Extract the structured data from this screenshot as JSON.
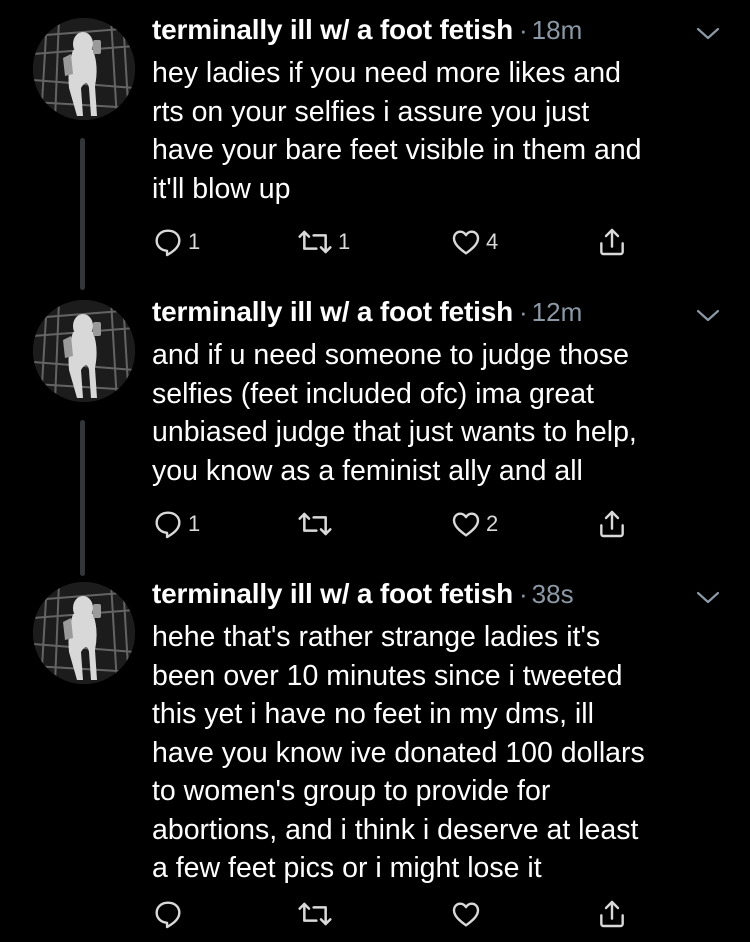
{
  "tweets": [
    {
      "author": "terminally ill w/ a foot fetish",
      "separator": "·",
      "time": "18m",
      "text": "hey ladies if you need more likes and\nrts on your selfies i assure you just\nhave your bare feet visible in them and\nit'll blow up",
      "replies": "1",
      "retweets": "1",
      "likes": "4"
    },
    {
      "author": "terminally ill w/ a foot fetish",
      "separator": "·",
      "time": "12m",
      "text": "and if u need someone to judge those\nselfies (feet included ofc) ima great\nunbiased judge that just wants to help,\nyou know as a feminist ally and all",
      "replies": "1",
      "retweets": "",
      "likes": "2"
    },
    {
      "author": "terminally ill w/ a foot fetish",
      "separator": "·",
      "time": "38s",
      "text": "hehe that's rather strange ladies it's\nbeen over 10 minutes since i tweeted\nthis yet i have no feet in my dms, ill\nhave you know ive donated 100 dollars\nto women's group to provide for\nabortions, and i think i deserve at least\na few feet pics or i might lose it",
      "replies": "",
      "retweets": "",
      "likes": ""
    }
  ],
  "icons": {
    "reply": "reply-icon",
    "retweet": "retweet-icon",
    "like": "like-icon",
    "share": "share-icon",
    "menu": "chevron-down-icon"
  },
  "colors": {
    "background": "#000000",
    "text": "#ffffff",
    "secondary": "#8b98a5",
    "thread_line": "#333639"
  }
}
